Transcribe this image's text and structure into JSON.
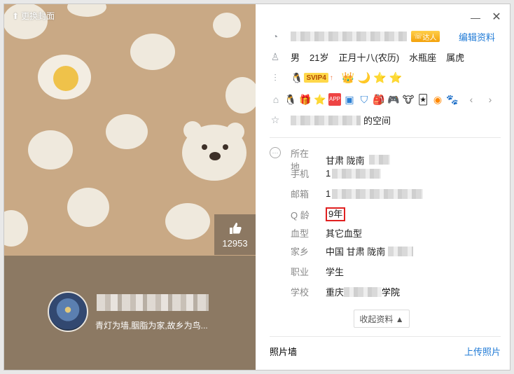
{
  "cover": {
    "change_cover_label": "更换封面",
    "like_count": "12953",
    "signature": "青灯为墙,胭脂为家,故乡为鸟..."
  },
  "window": {
    "minimize": "—",
    "close": "✕"
  },
  "profile": {
    "edit_label": "编辑资料",
    "daren_badge": "达人",
    "gender": "男",
    "age": "21岁",
    "birthday": "正月十八(农历)",
    "constellation": "水瓶座",
    "zodiac": "属虎",
    "svip_label": "SVIP4",
    "level_icons": [
      "crown-icon",
      "moon-icon",
      "star-icon",
      "star-icon"
    ],
    "space_suffix": "的空间"
  },
  "details": [
    {
      "label": "所在地",
      "value": "甘肃 陇南"
    },
    {
      "label": "手机",
      "value": "1"
    },
    {
      "label": "邮箱",
      "value": "1"
    },
    {
      "label": "Q 龄",
      "value": "9年"
    },
    {
      "label": "血型",
      "value": "其它血型"
    },
    {
      "label": "家乡",
      "value": "中国 甘肃 陇南"
    },
    {
      "label": "职业",
      "value": "学生"
    },
    {
      "label": "学校",
      "value": "重庆"
    },
    {
      "label": "",
      "value": "学院"
    }
  ],
  "collapse_label": "收起资料 ▲",
  "photo_wall": {
    "title": "照片墙",
    "upload_label": "上传照片"
  }
}
